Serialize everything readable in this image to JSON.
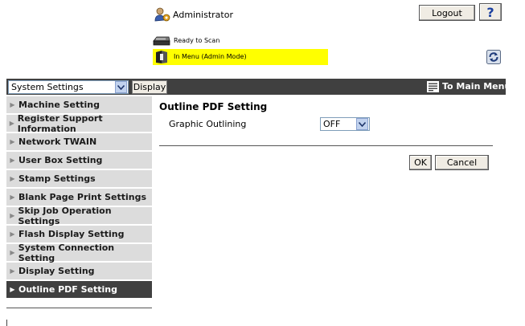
{
  "header": {
    "user_label": "Administrator",
    "logout_label": "Logout",
    "help_label": "?",
    "scan_status": "Ready to Scan",
    "mode_status": "In Menu (Admin Mode)"
  },
  "toolbar": {
    "settings_select_value": "System Settings",
    "display_button_label": "Display",
    "main_menu_label": "To Main Menu"
  },
  "sidebar": {
    "items": [
      {
        "label": "Machine Setting"
      },
      {
        "label": "Register Support Information"
      },
      {
        "label": "Network TWAIN"
      },
      {
        "label": "User Box Setting"
      },
      {
        "label": "Stamp Settings"
      },
      {
        "label": "Blank Page Print Settings"
      },
      {
        "label": "Skip Job Operation Settings"
      },
      {
        "label": "Flash Display Setting"
      },
      {
        "label": "System Connection Setting"
      },
      {
        "label": "Display Setting"
      },
      {
        "label": "Outline PDF Setting",
        "active": true
      }
    ]
  },
  "main": {
    "title": "Outline PDF Setting",
    "graphic_outlining_label": "Graphic Outlining",
    "graphic_outlining_value": "OFF",
    "ok_label": "OK",
    "cancel_label": "Cancel"
  },
  "icons": {
    "admin": "administrator-icon",
    "scanner": "scanner-icon",
    "status": "status-book-icon",
    "refresh": "refresh-icon",
    "menu": "menu-list-icon"
  },
  "colors": {
    "status_highlight": "#ffff00",
    "bar_dark": "#404040",
    "sidebar_bg": "#dcdcdc",
    "help_blue": "#1a3fa0"
  }
}
